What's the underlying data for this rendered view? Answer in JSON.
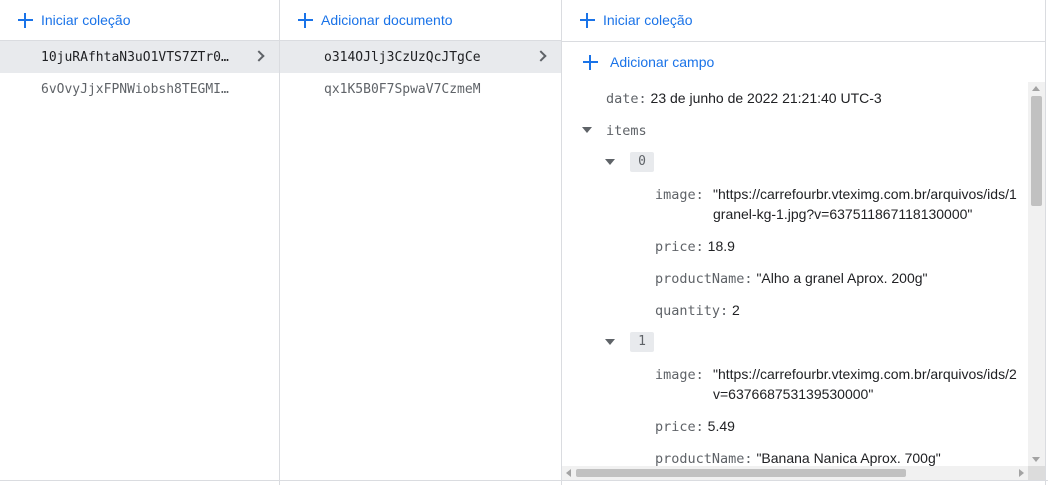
{
  "collections_panel": {
    "action_label": "Iniciar coleção",
    "items": [
      {
        "label": "10juRAfhtaN3uO1VTS7ZTr0…"
      },
      {
        "label": "6vOvyJjxFPNWiobsh8TEGMI…"
      }
    ]
  },
  "documents_panel": {
    "action_label": "Adicionar documento",
    "items": [
      {
        "label": "o314OJlj3CzUzQcJTgCe"
      },
      {
        "label": "qx1K5B0F7SpwaV7CzmeM"
      }
    ]
  },
  "fields_panel": {
    "action_label": "Iniciar coleção",
    "add_field_label": "Adicionar campo",
    "date": {
      "key": "date:",
      "value": "23 de junho de 2022 21:21:40 UTC-3"
    },
    "items_key": "items",
    "items": [
      {
        "index": "0",
        "image_key": "image:",
        "image_line1": "\"https://carrefourbr.vteximg.com.br/arquivos/ids/1",
        "image_line2": "granel-kg-1.jpg?v=637511867118130000\"",
        "price_key": "price:",
        "price": "18.9",
        "name_key": "productName:",
        "name": "\"Alho a granel Aprox. 200g\"",
        "qty_key": "quantity:",
        "qty": "2"
      },
      {
        "index": "1",
        "image_key": "image:",
        "image_line1": "\"https://carrefourbr.vteximg.com.br/arquivos/ids/2",
        "image_line2": "v=637668753139530000\"",
        "price_key": "price:",
        "price": "5.49",
        "name_key": "productName:",
        "name": "\"Banana Nanica Aprox. 700g\""
      }
    ]
  },
  "colors": {
    "accent": "#1a73e8",
    "selected_bg": "#e8eaed",
    "border": "#dadce0"
  }
}
